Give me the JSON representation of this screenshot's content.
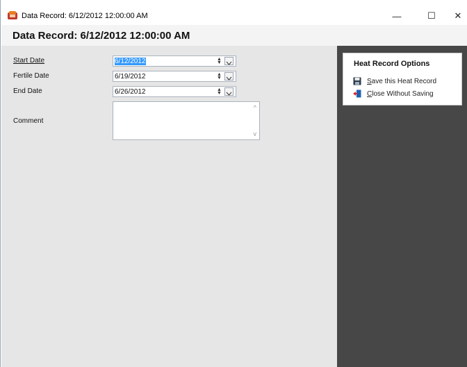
{
  "window": {
    "title": "Data Record: 6/12/2012 12:00:00 AM",
    "minimize": "—",
    "maximize": "☐",
    "close": "✕"
  },
  "header": {
    "title": "Data Record: 6/12/2012 12:00:00 AM"
  },
  "form": {
    "start_date": {
      "label": "Start Date",
      "value": "6/12/2012"
    },
    "fertile_date": {
      "label": "Fertile Date",
      "value": "6/19/2012"
    },
    "end_date": {
      "label": "End Date",
      "value": "6/26/2012"
    },
    "comment": {
      "label": "Comment",
      "value": ""
    }
  },
  "options": {
    "title": "Heat Record Options",
    "save": {
      "mnemonic": "S",
      "rest": "ave this Heat Record",
      "icon": "save-disk-icon"
    },
    "close": {
      "mnemonic": "C",
      "rest": "lose Without Saving",
      "icon": "exit-door-icon"
    }
  },
  "colors": {
    "side_panel_bg": "#474747",
    "main_bg": "#e6e6e6",
    "selection": "#3399ff"
  }
}
